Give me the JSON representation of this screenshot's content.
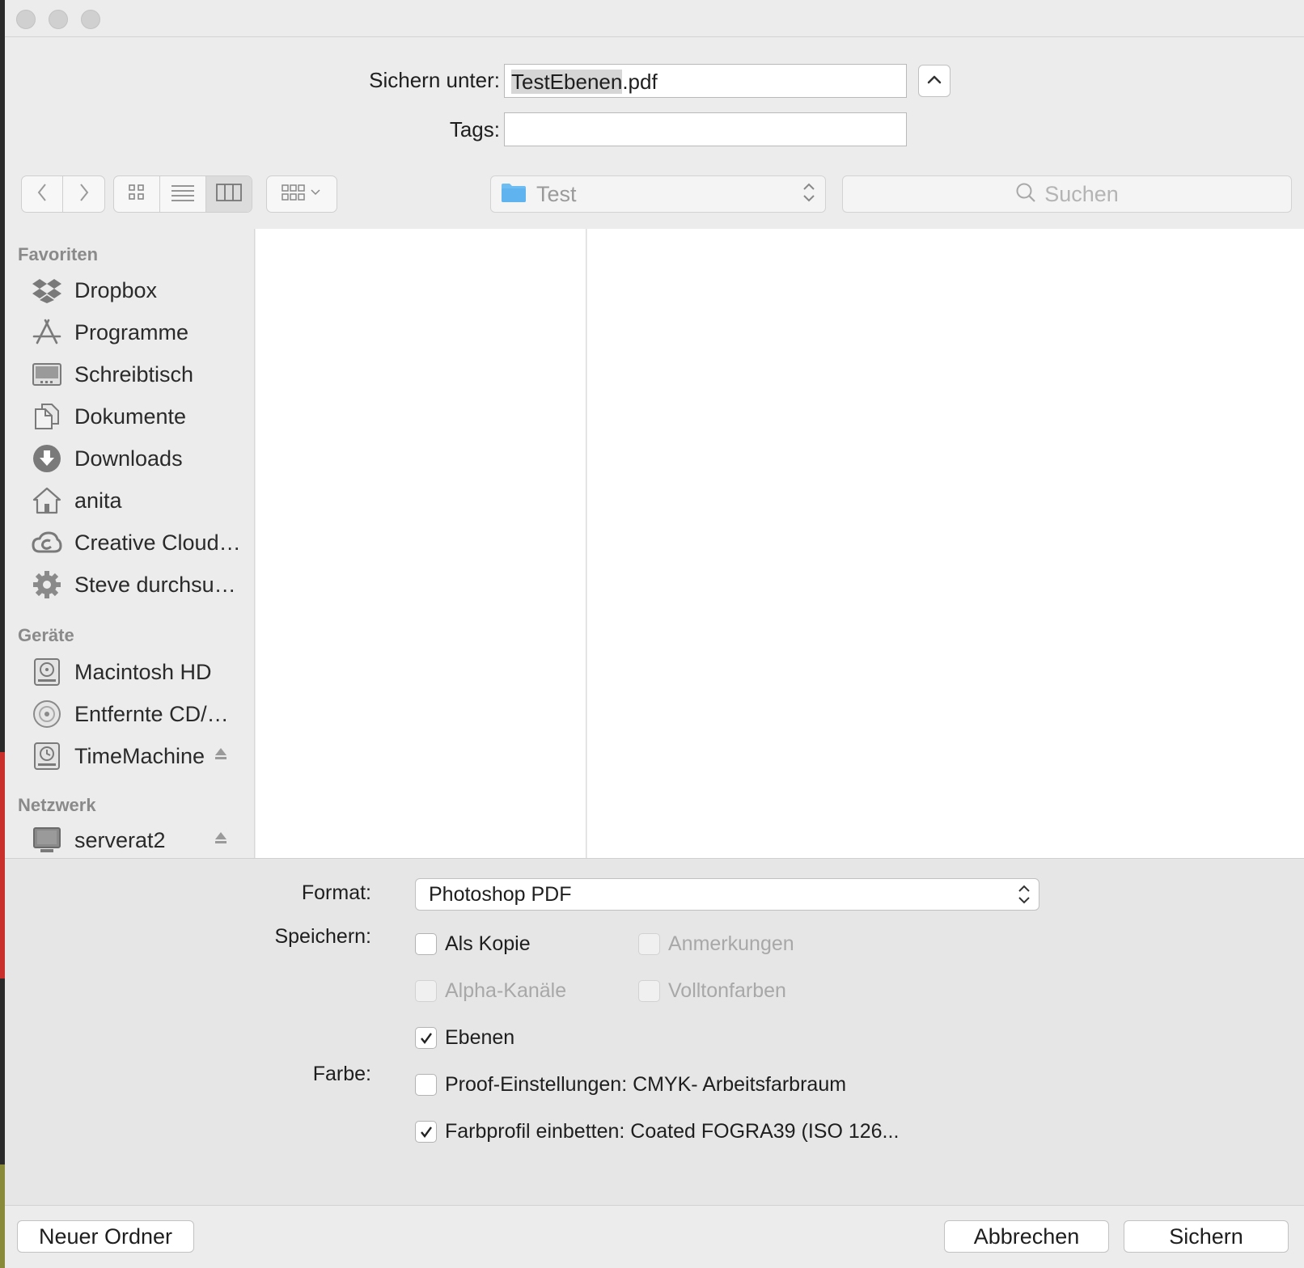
{
  "save": {
    "label": "Sichern unter:",
    "filename_selected": "TestEbenen",
    "filename_ext": ".pdf",
    "tags_label": "Tags:",
    "tags_value": ""
  },
  "toolbar": {
    "back_icon": "chevron-left-icon",
    "forward_icon": "chevron-right-icon",
    "view_modes": [
      "icon-view",
      "list-view",
      "column-view"
    ],
    "active_view": "column-view",
    "arrange_icon": "arrange-grid-icon",
    "location": "Test",
    "search_placeholder": "Suchen"
  },
  "sidebar": {
    "favorites_header": "Favoriten",
    "favorites": [
      {
        "label": "Dropbox",
        "icon": "dropbox-icon"
      },
      {
        "label": "Programme",
        "icon": "applications-icon"
      },
      {
        "label": "Schreibtisch",
        "icon": "desktop-icon"
      },
      {
        "label": "Dokumente",
        "icon": "documents-icon"
      },
      {
        "label": "Downloads",
        "icon": "downloads-icon"
      },
      {
        "label": "anita",
        "icon": "home-icon"
      },
      {
        "label": "Creative Cloud…",
        "icon": "creative-cloud-icon"
      },
      {
        "label": "Steve durchsu…",
        "icon": "gear-icon"
      }
    ],
    "devices_header": "Geräte",
    "devices": [
      {
        "label": "Macintosh HD",
        "icon": "hard-disk-icon"
      },
      {
        "label": "Entfernte CD/…",
        "icon": "cd-icon"
      },
      {
        "label": "TimeMachine",
        "icon": "time-machine-icon",
        "eject": true
      }
    ],
    "network_header": "Netzwerk",
    "network": [
      {
        "label": "serverat2",
        "icon": "server-icon",
        "eject": true
      }
    ]
  },
  "options": {
    "format_label": "Format:",
    "format_value": "Photoshop PDF",
    "save_label": "Speichern:",
    "color_label": "Farbe:",
    "checkboxes": {
      "als_kopie": {
        "label": "Als Kopie",
        "checked": false,
        "enabled": true
      },
      "anmerkungen": {
        "label": "Anmerkungen",
        "checked": false,
        "enabled": false
      },
      "alpha": {
        "label": "Alpha-Kanäle",
        "checked": false,
        "enabled": false
      },
      "volltonfarben": {
        "label": "Volltonfarben",
        "checked": false,
        "enabled": false
      },
      "ebenen": {
        "label": "Ebenen",
        "checked": true,
        "enabled": true
      },
      "proof": {
        "label": "Proof-Einstellungen: CMYK- Arbeitsfarbraum",
        "checked": false,
        "enabled": true
      },
      "farbprofil": {
        "label": "Farbprofil einbetten: Coated FOGRA39 (ISO 126...",
        "checked": true,
        "enabled": true
      }
    }
  },
  "buttons": {
    "new_folder": "Neuer Ordner",
    "cancel": "Abbrechen",
    "save": "Sichern"
  },
  "colors": {
    "folder_blue": "#5fb4f0",
    "window_bg": "#ececec"
  }
}
